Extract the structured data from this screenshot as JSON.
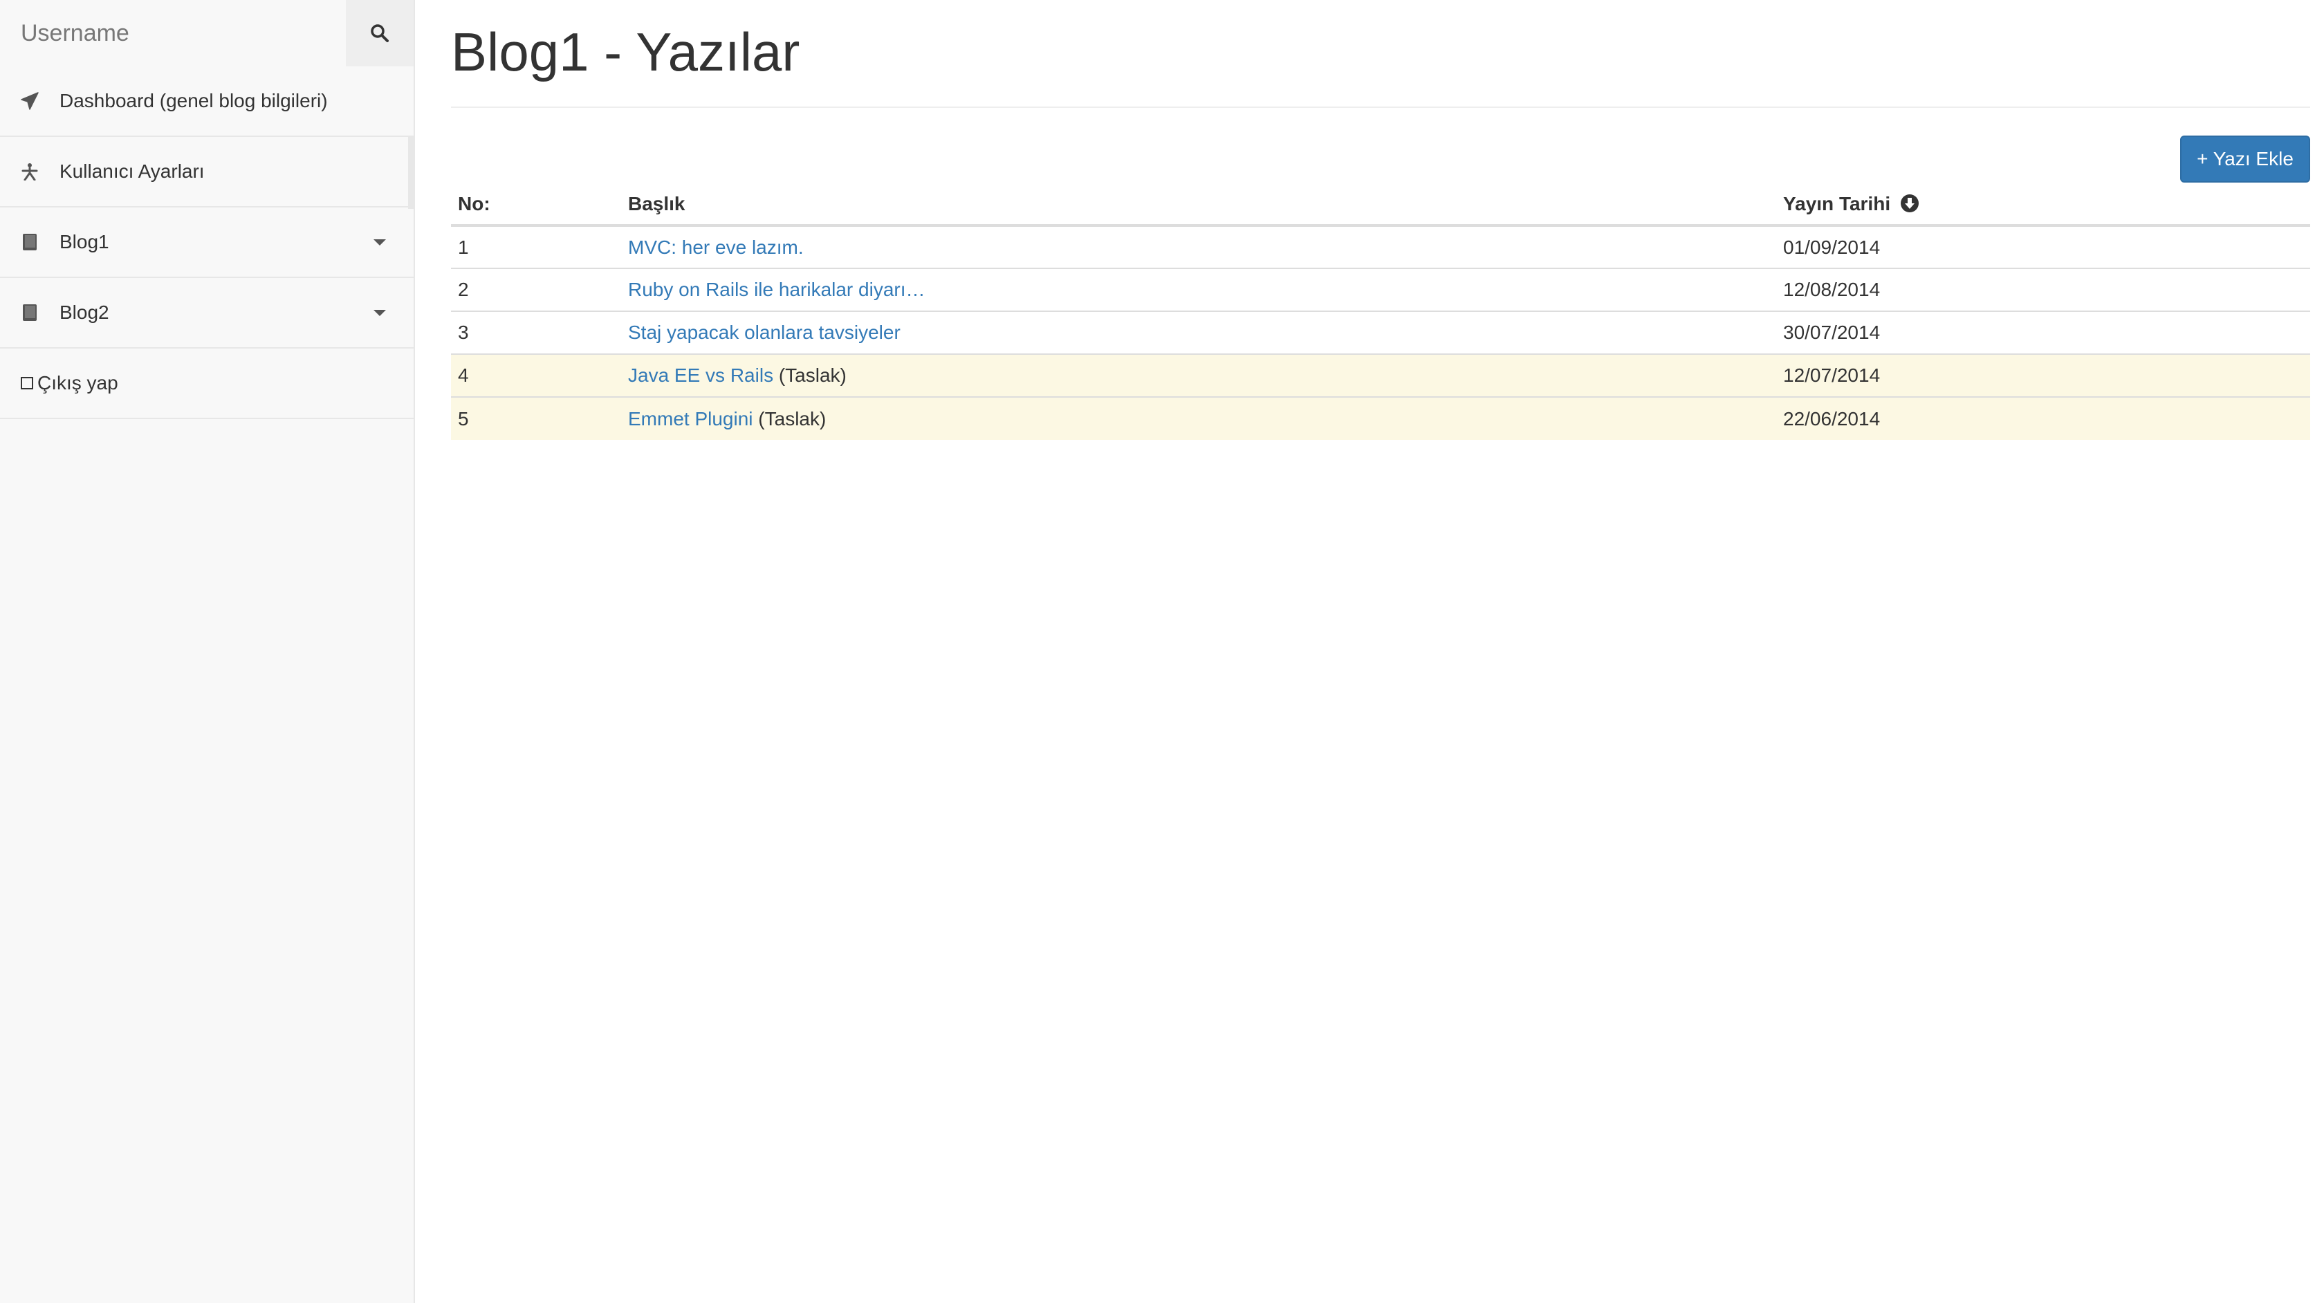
{
  "sidebar": {
    "search": {
      "placeholder": "Username",
      "icon": "search-icon"
    },
    "items": [
      {
        "label": "Dashboard (genel blog bilgileri)",
        "icon": "paper-plane-icon"
      },
      {
        "label": "Kullanıcı Ayarları",
        "icon": "person-icon"
      },
      {
        "label": "Blog1",
        "icon": "book-icon",
        "has_caret": true
      },
      {
        "label": "Blog2",
        "icon": "book-icon",
        "has_caret": true
      },
      {
        "label": "Çıkış yap",
        "icon": "square-icon"
      }
    ]
  },
  "main": {
    "title": "Blog1 - Yazılar",
    "add_button_label": "+ Yazı Ekle",
    "table": {
      "headers": {
        "no": "No:",
        "title": "Başlık",
        "date": "Yayın Tarihi",
        "date_sort_icon": "sort-down-circle-icon"
      },
      "rows": [
        {
          "no": "1",
          "title": "MVC: her eve lazım.",
          "draft_label": "",
          "date": "01/09/2014",
          "draft": false
        },
        {
          "no": "2",
          "title": "Ruby on Rails ile harikalar diyarı…",
          "draft_label": "",
          "date": "12/08/2014",
          "draft": false
        },
        {
          "no": "3",
          "title": "Staj yapacak olanlara tavsiyeler",
          "draft_label": "",
          "date": "30/07/2014",
          "draft": false
        },
        {
          "no": "4",
          "title": "Java EE vs Rails",
          "draft_label": "(Taslak)",
          "date": "12/07/2014",
          "draft": true
        },
        {
          "no": "5",
          "title": "Emmet Plugini",
          "draft_label": "(Taslak)",
          "date": "22/06/2014",
          "draft": true
        }
      ]
    }
  },
  "colors": {
    "link": "#337ab7",
    "primary_button": "#337ab7",
    "draft_row": "#fcf8e3",
    "sidebar_bg": "#f8f8f8"
  }
}
